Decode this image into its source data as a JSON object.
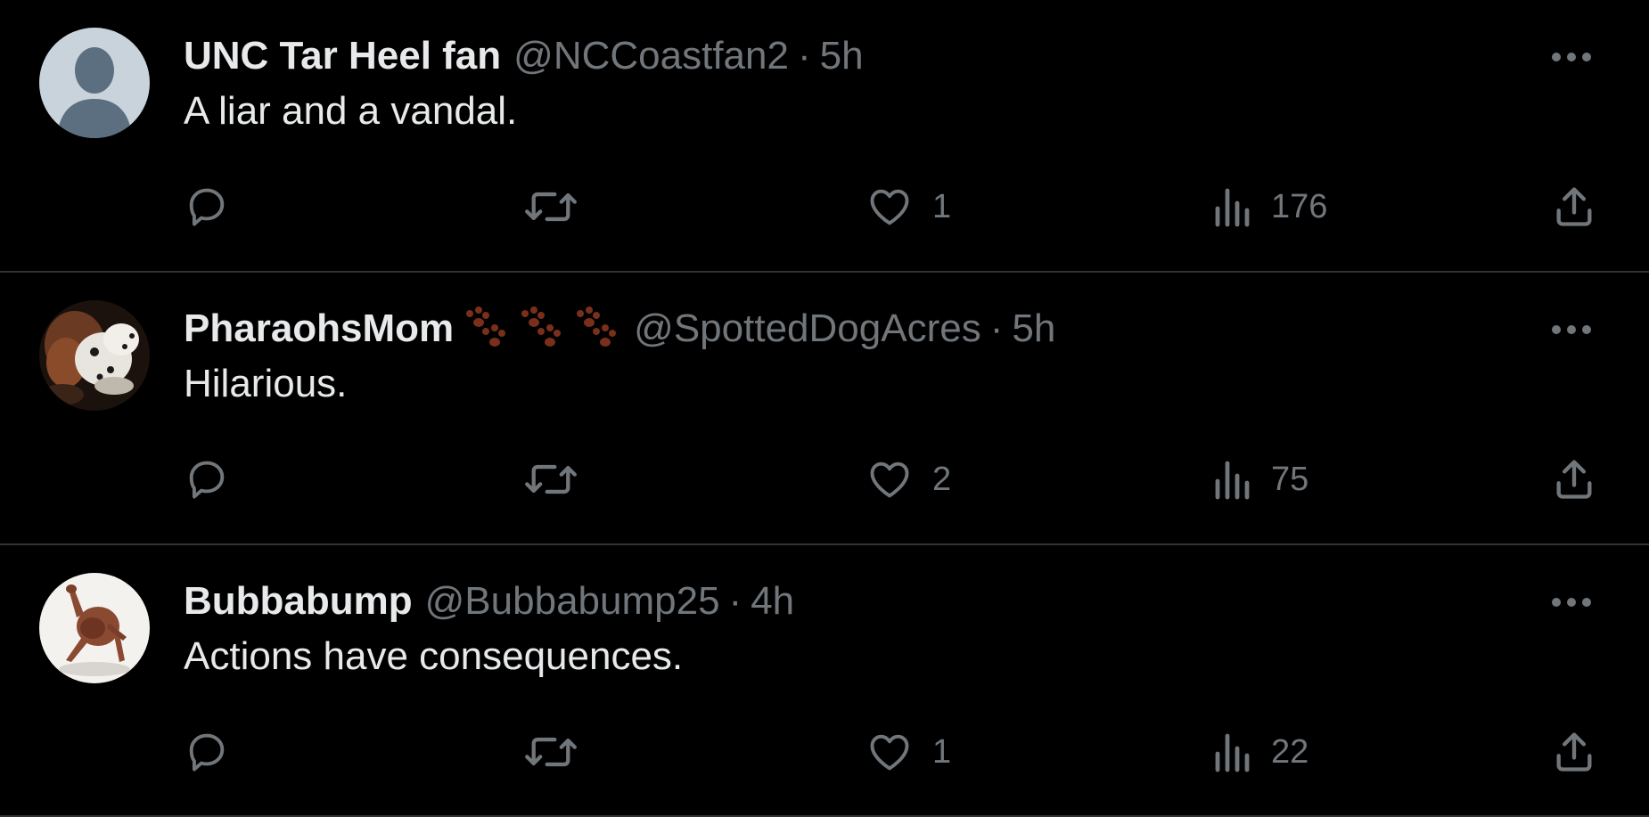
{
  "tweets": [
    {
      "name": "UNC Tar Heel fan",
      "emoji": "",
      "handle": "@NCCoastfan2",
      "separator": "·",
      "time": "5h",
      "text": "A liar and a vandal.",
      "likes": "1",
      "views": "176",
      "avatar": "default-avatar"
    },
    {
      "name": "PharaohsMom",
      "emoji": "🐾🐾🐾",
      "handle": "@SpottedDogAcres",
      "separator": "·",
      "time": "5h",
      "text": "Hilarious.",
      "likes": "2",
      "views": "75",
      "avatar": "dalmatian-photo"
    },
    {
      "name": "Bubbabump",
      "emoji": "",
      "handle": "@Bubbabump25",
      "separator": "·",
      "time": "4h",
      "text": "Actions have consequences.",
      "likes": "1",
      "views": "22",
      "avatar": "figure-photo"
    }
  ],
  "colors": {
    "background": "#000000",
    "primary_text": "#e7e9ea",
    "secondary_text": "#71767b",
    "divider": "#2f3336",
    "paw": "#7a2f1c"
  },
  "icons": {
    "reply": "reply-icon",
    "retweet": "retweet-icon",
    "like": "heart-icon",
    "views": "views-icon",
    "share": "share-icon",
    "more": "more-icon"
  }
}
